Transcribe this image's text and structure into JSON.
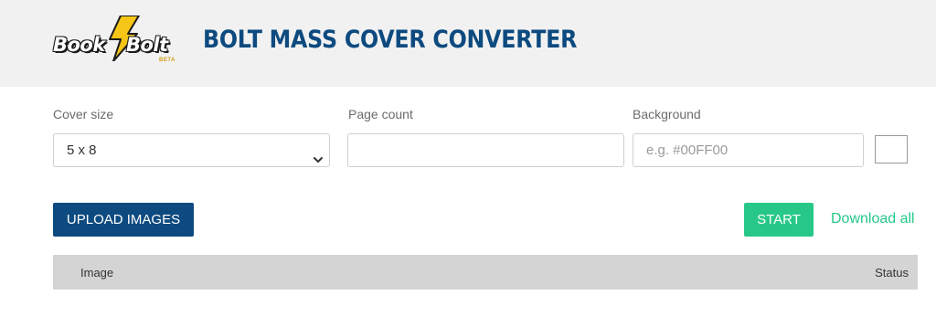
{
  "header": {
    "logo": {
      "word1": "Book",
      "word2": "Bolt",
      "badge": "BETA"
    },
    "title": "BOLT MASS COVER CONVERTER"
  },
  "form": {
    "cover_size": {
      "label": "Cover size",
      "selected": "5 x 8"
    },
    "page_count": {
      "label": "Page count",
      "value": "",
      "placeholder": ""
    },
    "background": {
      "label": "Background",
      "value": "",
      "placeholder": "e.g. #00FF00",
      "swatch_color": "#ffffff"
    }
  },
  "actions": {
    "upload_label": "UPLOAD IMAGES",
    "start_label": "START",
    "download_all_label": "Download all"
  },
  "table": {
    "columns": [
      "Image",
      "Status"
    ]
  },
  "colors": {
    "brand_blue": "#0d4a7f",
    "accent_green": "#27c887",
    "header_bg": "#f1f1f1",
    "table_header_bg": "#d4d4d4"
  },
  "icons": {
    "logo_mark": "lightning-bolt-icon",
    "select_arrow": "chevron-down-icon"
  }
}
